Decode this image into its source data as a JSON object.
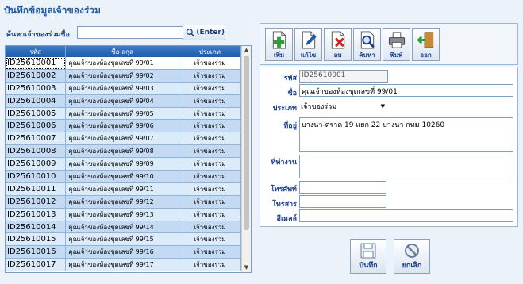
{
  "window": {
    "title": "บันทึกข้อมูลเจ้าของร่วม"
  },
  "search": {
    "label": "ค้นหาเจ้าของร่วมชื่อ",
    "value": "",
    "button_label": "(Enter)"
  },
  "grid": {
    "columns": [
      "รหัส",
      "ชื่อ-สกุล",
      "ประเภท"
    ],
    "rows": [
      {
        "id": "ID25610001",
        "name": "คุณเจ้าของห้องชุดเลขที่ 99/01",
        "type": "เจ้าของร่วม"
      },
      {
        "id": "ID25610002",
        "name": "คุณเจ้าของห้องชุดเลขที่ 99/02",
        "type": "เจ้าของร่วม"
      },
      {
        "id": "ID25610003",
        "name": "คุณเจ้าของห้องชุดเลขที่ 99/03",
        "type": "เจ้าของร่วม"
      },
      {
        "id": "ID25610004",
        "name": "คุณเจ้าของห้องชุดเลขที่ 99/04",
        "type": "เจ้าของร่วม"
      },
      {
        "id": "ID25610005",
        "name": "คุณเจ้าของห้องชุดเลขที่ 99/05",
        "type": "เจ้าของร่วม"
      },
      {
        "id": "ID25610006",
        "name": "คุณเจ้าของห้องชุดเลขที่ 99/06",
        "type": "เจ้าของร่วม"
      },
      {
        "id": "ID25610007",
        "name": "คุณเจ้าของห้องชุดเลขที่ 99/07",
        "type": "เจ้าของร่วม"
      },
      {
        "id": "ID25610008",
        "name": "คุณเจ้าของห้องชุดเลขที่ 99/08",
        "type": "เจ้าของร่วม"
      },
      {
        "id": "ID25610009",
        "name": "คุณเจ้าของห้องชุดเลขที่ 99/09",
        "type": "เจ้าของร่วม"
      },
      {
        "id": "ID25610010",
        "name": "คุณเจ้าของห้องชุดเลขที่ 99/10",
        "type": "เจ้าของร่วม"
      },
      {
        "id": "ID25610011",
        "name": "คุณเจ้าของห้องชุดเลขที่ 99/11",
        "type": "เจ้าของร่วม"
      },
      {
        "id": "ID25610012",
        "name": "คุณเจ้าของห้องชุดเลขที่ 99/12",
        "type": "เจ้าของร่วม"
      },
      {
        "id": "ID25610013",
        "name": "คุณเจ้าของห้องชุดเลขที่ 99/13",
        "type": "เจ้าของร่วม"
      },
      {
        "id": "ID25610014",
        "name": "คุณเจ้าของห้องชุดเลขที่ 99/14",
        "type": "เจ้าของร่วม"
      },
      {
        "id": "ID25610015",
        "name": "คุณเจ้าของห้องชุดเลขที่ 99/15",
        "type": "เจ้าของร่วม"
      },
      {
        "id": "ID25610016",
        "name": "คุณเจ้าของห้องชุดเลขที่ 99/16",
        "type": "เจ้าของร่วม"
      },
      {
        "id": "ID25610017",
        "name": "คุณเจ้าของห้องชุดเลขที่ 99/17",
        "type": "เจ้าของร่วม"
      }
    ]
  },
  "toolbar": {
    "add": "เพิ่ม",
    "edit": "แก้ไข",
    "delete": "ลบ",
    "find": "ค้นหา",
    "print": "พิมพ์",
    "exit": "ออก"
  },
  "form": {
    "code_label": "รหัส",
    "code_value": "ID25610001",
    "name_label": "ชื่อ",
    "name_value": "คุณเจ้าของห้องชุดเลขที่ 99/01",
    "type_label": "ประเภท",
    "type_value": "เจ้าของร่วม",
    "address_label": "ที่อยู่",
    "address_value": "บางนา-ตราด 19 แยก 22 บางนา กทม 10260",
    "workplace_label": "ที่ทำงาน",
    "workplace_value": "",
    "phone_label": "โทรศัพท์",
    "phone_value": "",
    "fax_label": "โทรสาร",
    "fax_value": "",
    "email_label": "อีเมลล์",
    "email_value": ""
  },
  "bottom": {
    "save": "บันทึก",
    "cancel": "ยกเลิก"
  },
  "colors": {
    "accent": "#1f5aa6",
    "header": "#2b6cbf",
    "row_even": "#dcebf9",
    "row_odd": "#c4daf2"
  }
}
